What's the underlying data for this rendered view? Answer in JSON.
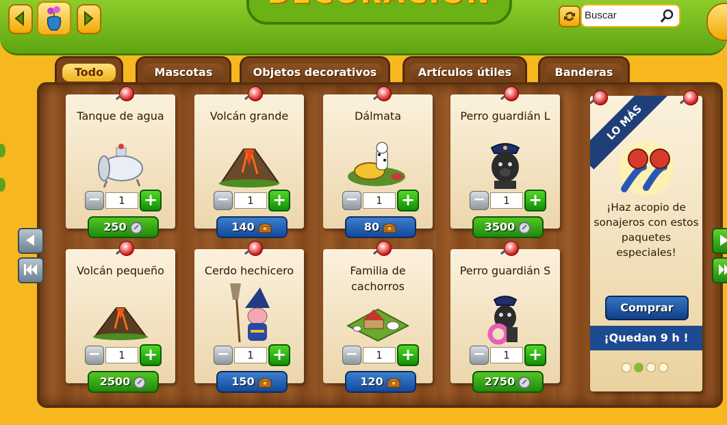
{
  "header": {
    "title": "DECORACIÓN",
    "search_placeholder": "Buscar",
    "prev_icon": "arrow-left-icon",
    "next_icon": "arrow-right-icon",
    "category_icon": "vase-icon"
  },
  "tabs": [
    {
      "label": "Todo",
      "active": true
    },
    {
      "label": "Mascotas",
      "active": false
    },
    {
      "label": "Objetos decorativos",
      "active": false
    },
    {
      "label": "Artículos útiles",
      "active": false
    },
    {
      "label": "Banderas",
      "active": false
    }
  ],
  "items": [
    {
      "name": "Tanque de agua",
      "qty": "1",
      "price": "250",
      "currency": "coins"
    },
    {
      "name": "Volcán grande",
      "qty": "1",
      "price": "140",
      "currency": "chest"
    },
    {
      "name": "Dálmata",
      "qty": "1",
      "price": "80",
      "currency": "chest"
    },
    {
      "name": "Perro guardián L",
      "qty": "1",
      "price": "3500",
      "currency": "coins"
    },
    {
      "name": "Volcán pequeño",
      "qty": "1",
      "price": "2500",
      "currency": "coins"
    },
    {
      "name": "Cerdo hechicero",
      "qty": "1",
      "price": "150",
      "currency": "chest"
    },
    {
      "name": "Familia de cachorros",
      "qty": "1",
      "price": "120",
      "currency": "chest"
    },
    {
      "name": "Perro guardián S",
      "qty": "1",
      "price": "2750",
      "currency": "coins"
    }
  ],
  "promo": {
    "ribbon": "LO MÁS",
    "text": "¡Haz acopio de sonajeros con estos paquetes especiales!",
    "buy_label": "Comprar",
    "timer": "¡Quedan 9 h !",
    "page_count": 4,
    "active_page": 2
  },
  "colors": {
    "accent_green": "#5fa511",
    "price_green": "#1f8a0c",
    "price_blue": "#134a98",
    "background": "#f6b81e"
  }
}
